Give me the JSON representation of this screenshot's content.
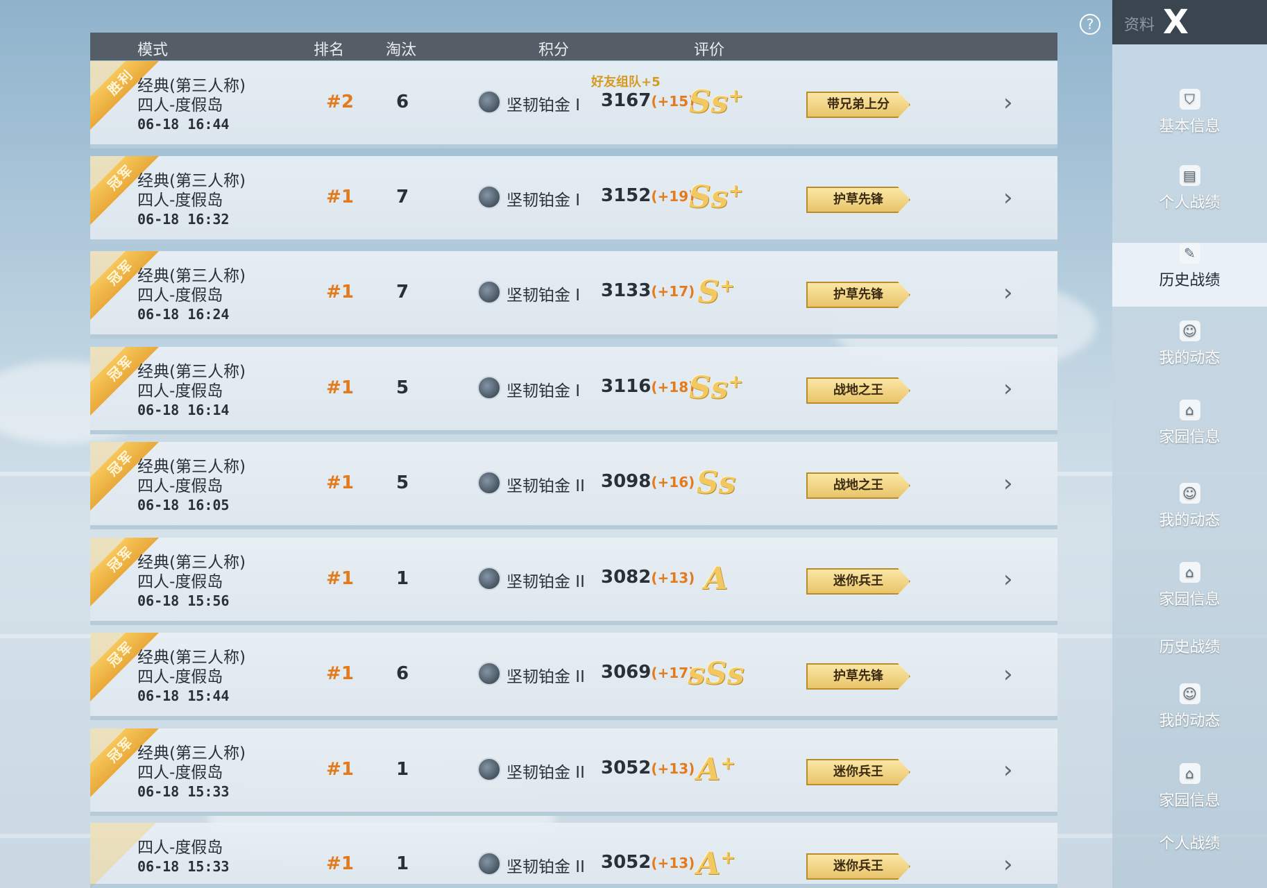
{
  "header": {
    "col_mode": "模式",
    "col_rank": "排名",
    "col_kills": "淘汰",
    "col_score": "积分",
    "col_grade": "评价"
  },
  "help_icon": "?",
  "top_right": {
    "label": "资料",
    "close": "X"
  },
  "rows": [
    {
      "ribbon": "胜利",
      "mode": "经典(第三人称)",
      "map": "四人-度假岛",
      "time": "06-18 16:44",
      "rank": "#2",
      "kills": "6",
      "tier": "坚韧铂金 I",
      "score": "3167",
      "delta": "(+15)",
      "bonus": "好友组队+5",
      "grade": "Ss",
      "grade_sup": "+",
      "badge": "带兄弟上分"
    },
    {
      "ribbon": "冠军",
      "mode": "经典(第三人称)",
      "map": "四人-度假岛",
      "time": "06-18 16:32",
      "rank": "#1",
      "kills": "7",
      "tier": "坚韧铂金 I",
      "score": "3152",
      "delta": "(+19)",
      "bonus": "",
      "grade": "Ss",
      "grade_sup": "+",
      "badge": "护草先锋"
    },
    {
      "ribbon": "冠军",
      "mode": "经典(第三人称)",
      "map": "四人-度假岛",
      "time": "06-18 16:24",
      "rank": "#1",
      "kills": "7",
      "tier": "坚韧铂金 I",
      "score": "3133",
      "delta": "(+17)",
      "bonus": "",
      "grade": "S",
      "grade_sup": "+",
      "badge": "护草先锋"
    },
    {
      "ribbon": "冠军",
      "mode": "经典(第三人称)",
      "map": "四人-度假岛",
      "time": "06-18 16:14",
      "rank": "#1",
      "kills": "5",
      "tier": "坚韧铂金 I",
      "score": "3116",
      "delta": "(+18)",
      "bonus": "",
      "grade": "Ss",
      "grade_sup": "+",
      "badge": "战地之王"
    },
    {
      "ribbon": "冠军",
      "mode": "经典(第三人称)",
      "map": "四人-度假岛",
      "time": "06-18 16:05",
      "rank": "#1",
      "kills": "5",
      "tier": "坚韧铂金 II",
      "score": "3098",
      "delta": "(+16)",
      "bonus": "",
      "grade": "Ss",
      "grade_sup": "",
      "badge": "战地之王"
    },
    {
      "ribbon": "冠军",
      "mode": "经典(第三人称)",
      "map": "四人-度假岛",
      "time": "06-18 15:56",
      "rank": "#1",
      "kills": "1",
      "tier": "坚韧铂金 II",
      "score": "3082",
      "delta": "(+13)",
      "bonus": "",
      "grade": "A",
      "grade_sup": "",
      "badge": "迷你兵王"
    },
    {
      "ribbon": "冠军",
      "mode": "经典(第三人称)",
      "map": "四人-度假岛",
      "time": "06-18 15:44",
      "rank": "#1",
      "kills": "6",
      "tier": "坚韧铂金 II",
      "score": "3069",
      "delta": "(+17)",
      "bonus": "",
      "grade": "sSs",
      "grade_sup": "",
      "badge": "护草先锋"
    },
    {
      "ribbon": "冠军",
      "mode": "经典(第三人称)",
      "map": "四人-度假岛",
      "time": "06-18 15:33",
      "rank": "#1",
      "kills": "1",
      "tier": "坚韧铂金 II",
      "score": "3052",
      "delta": "(+13)",
      "bonus": "",
      "grade": "A",
      "grade_sup": "+",
      "badge": "迷你兵王"
    },
    {
      "ribbon": "",
      "mode": "",
      "map": "四人-度假岛",
      "time": "06-18 15:33",
      "rank": "#1",
      "kills": "1",
      "tier": "坚韧铂金 II",
      "score": "3052",
      "delta": "(+13)",
      "bonus": "",
      "grade": "A",
      "grade_sup": "+",
      "badge": "迷你兵王"
    }
  ],
  "sidebar": [
    {
      "label": "基本信息",
      "icon": "user-shield-icon",
      "glyph": "⛉"
    },
    {
      "label": "个人战绩",
      "icon": "report-icon",
      "glyph": "▤"
    },
    {
      "label": "历史战绩",
      "icon": "history-doc-icon",
      "glyph": "✎"
    },
    {
      "label": "我的动态",
      "icon": "smile-icon",
      "glyph": "☺"
    },
    {
      "label": "家园信息",
      "icon": "home-card-icon",
      "glyph": "⌂"
    },
    {
      "label": "我的动态",
      "icon": "smile-icon",
      "glyph": "☺"
    },
    {
      "label": "家园信息",
      "icon": "home-card-icon",
      "glyph": "⌂"
    },
    {
      "label": "历史战绩",
      "icon": "",
      "glyph": ""
    },
    {
      "label": "我的动态",
      "icon": "smile-icon",
      "glyph": "☺"
    },
    {
      "label": "家园信息",
      "icon": "home-card-icon",
      "glyph": "⌂"
    },
    {
      "label": "个人战绩",
      "icon": "",
      "glyph": ""
    }
  ]
}
